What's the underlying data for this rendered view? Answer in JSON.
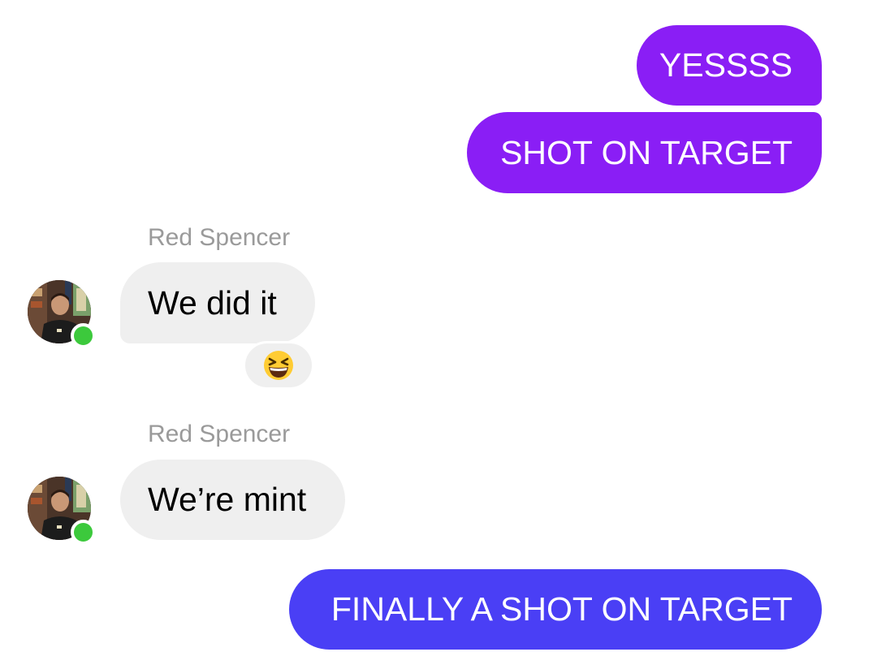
{
  "colors": {
    "outgoing_purple": "#8a1ef5",
    "outgoing_indigo": "#4a3ff5",
    "incoming_bubble": "#efefef",
    "sender_name": "#9a9a9a",
    "online_dot": "#3cc93c"
  },
  "messages": [
    {
      "direction": "outgoing",
      "text": "YESSSS"
    },
    {
      "direction": "outgoing",
      "text": "SHOT ON TARGET"
    },
    {
      "direction": "incoming",
      "sender": "Red Spencer",
      "text": "We did it",
      "reaction_icon": "laughing-face-emoji-icon"
    },
    {
      "direction": "incoming",
      "sender": "Red Spencer",
      "text": "We’re mint"
    },
    {
      "direction": "outgoing",
      "text": "FINALLY A SHOT ON TARGET"
    }
  ]
}
